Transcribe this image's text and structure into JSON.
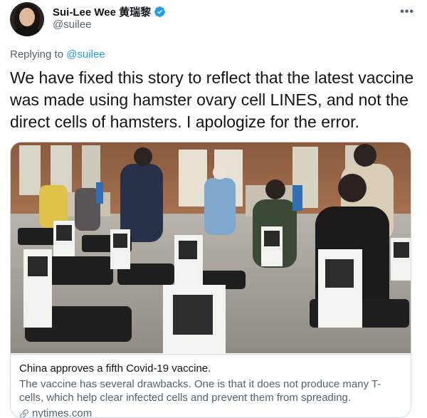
{
  "author": {
    "display_name": "Sui-Lee Wee 黄瑞黎",
    "handle": "@suilee",
    "verified": true
  },
  "menu": {
    "more_label": "•••"
  },
  "reply_context": {
    "prefix": "Replying to ",
    "mention": "@suilee"
  },
  "tweet": {
    "text": "We have fixed this story to reflect that the latest vaccine was made using hamster ovary cell LINES, and not the direct cells of hamsters. I apologize for the error."
  },
  "link_card": {
    "title": "China approves a fifth Covid-19 vaccine.",
    "description": "The vaccine has several drawbacks. One is that it does not produce many T-cells, which help clear infected cells and prevent them from spreading.",
    "domain": "nytimes.com"
  },
  "colors": {
    "accent": "#1d9bf0",
    "text": "#0f1419",
    "secondary": "#536471",
    "border": "#cfd9de"
  },
  "icons": [
    "verified-badge-icon",
    "more-icon",
    "link-icon"
  ]
}
